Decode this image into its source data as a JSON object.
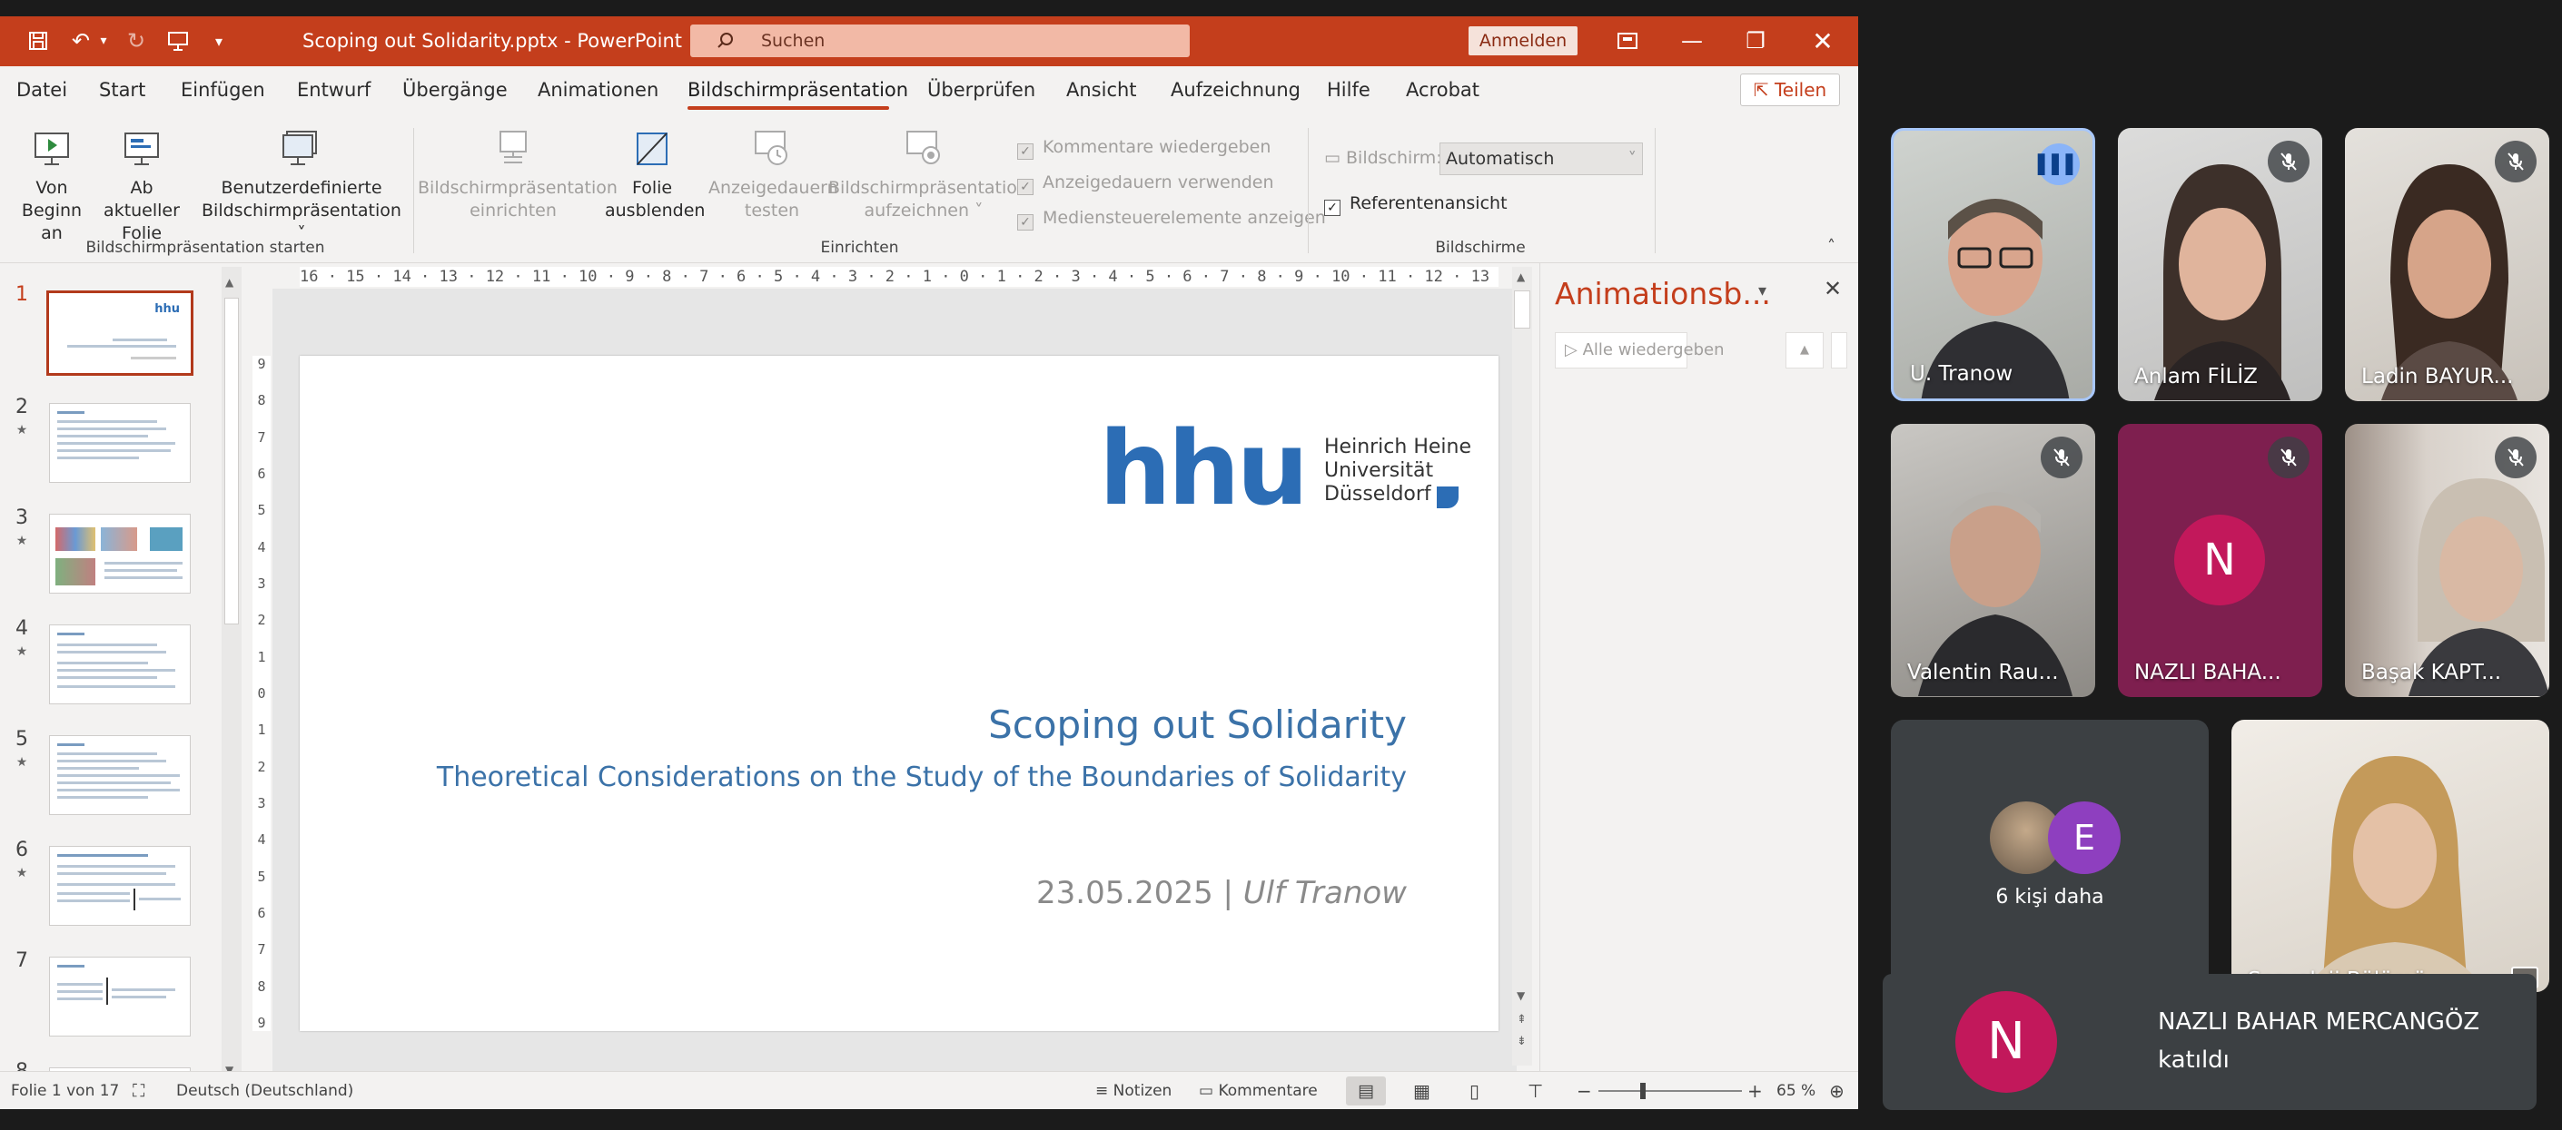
{
  "window": {
    "file_title": "Scoping out Solidarity.pptx",
    "app": "PowerPoint",
    "separator": " - ",
    "search_placeholder": "Suchen",
    "signin_label": "Anmelden",
    "colors": {
      "accent": "#c43e1c",
      "hhu_blue": "#2c6db5",
      "meet_bg": "#1b1b1b"
    }
  },
  "menu": {
    "items": [
      "Datei",
      "Start",
      "Einfügen",
      "Entwurf",
      "Übergänge",
      "Animationen",
      "Bildschirmpräsentation",
      "Überprüfen",
      "Ansicht",
      "Aufzeichnung",
      "Hilfe",
      "Acrobat"
    ],
    "active": "Bildschirmpräsentation",
    "share_label": "Teilen"
  },
  "ribbon": {
    "start": {
      "from_begin_1": "Von",
      "from_begin_2": "Beginn an",
      "from_current_1": "Ab aktueller",
      "from_current_2": "Folie",
      "custom_1": "Benutzerdefinierte",
      "custom_2": "Bildschirmpräsentation",
      "group": "Bildschirmpräsentation starten"
    },
    "setup": {
      "setup_1": "Bildschirmpräsentation",
      "setup_2": "einrichten",
      "hide_1": "Folie",
      "hide_2": "ausblenden",
      "rehearse_1": "Anzeigedauern",
      "rehearse_2": "testen",
      "record_1": "Bildschirmpräsentation",
      "record_2": "aufzeichnen",
      "check_comments": "Kommentare wiedergeben",
      "check_timings": "Anzeigedauern verwenden",
      "check_media": "Mediensteuerelemente anzeigen",
      "group": "Einrichten"
    },
    "monitors": {
      "monitor_label": "Bildschirm:",
      "monitor_value": "Automatisch",
      "presenter_view": "Referentenansicht",
      "group": "Bildschirme"
    }
  },
  "thumbnails": {
    "numbers": [
      "1",
      "2",
      "3",
      "4",
      "5",
      "6",
      "7",
      "8"
    ],
    "star": "★"
  },
  "ruler": {
    "horizontal": "16 · 15 · 14 · 13 · 12 · 11 · 10 · 9 · 8 · 7 · 6 · 5 · 4 · 3 · 2 · 1 · 0 · 1 · 2 · 3 · 4 · 5 · 6 · 7 · 8 · 9 · 10 · 11 · 12 · 13 · 14 · 15 · 16",
    "vertical": [
      "9",
      "8",
      "7",
      "6",
      "5",
      "4",
      "3",
      "2",
      "1",
      "0",
      "1",
      "2",
      "3",
      "4",
      "5",
      "6",
      "7",
      "8",
      "9"
    ]
  },
  "slide": {
    "logo": "hhu",
    "uni_1": "Heinrich Heine",
    "uni_2": "Universität",
    "uni_3": "Düsseldorf",
    "title": "Scoping out Solidarity",
    "subtitle": "Theoretical Considerations on the Study of the Boundaries of Solidarity",
    "date": "23.05.2025",
    "sep": " | ",
    "author": "Ulf Tranow"
  },
  "animation_pane": {
    "title": "Animationsb...",
    "play_all": "Alle wiedergeben"
  },
  "status": {
    "slide": "Folie 1 von 17",
    "language": "Deutsch (Deutschland)",
    "notes": "Notizen",
    "comments": "Kommentare",
    "zoom": "65 %"
  },
  "meet": {
    "tiles": [
      {
        "name": "U. Tranow",
        "speaking": true
      },
      {
        "name": "Anlam FİLİZ",
        "muted": true
      },
      {
        "name": "Ladin BAYUR...",
        "muted": true
      },
      {
        "name": "Valentin Rau...",
        "muted": true
      },
      {
        "name": "NAZLI BAHA...",
        "muted": true,
        "initial": "N"
      },
      {
        "name": "Başak KAPT...",
        "muted": true
      },
      {
        "name": "Sosyoloji Bölümü"
      }
    ],
    "others": {
      "label": "6 kişi daha",
      "initial": "E"
    },
    "notification": {
      "initial": "N",
      "name": "NAZLI BAHAR MERCANGÖZ",
      "text": "katıldı"
    }
  }
}
